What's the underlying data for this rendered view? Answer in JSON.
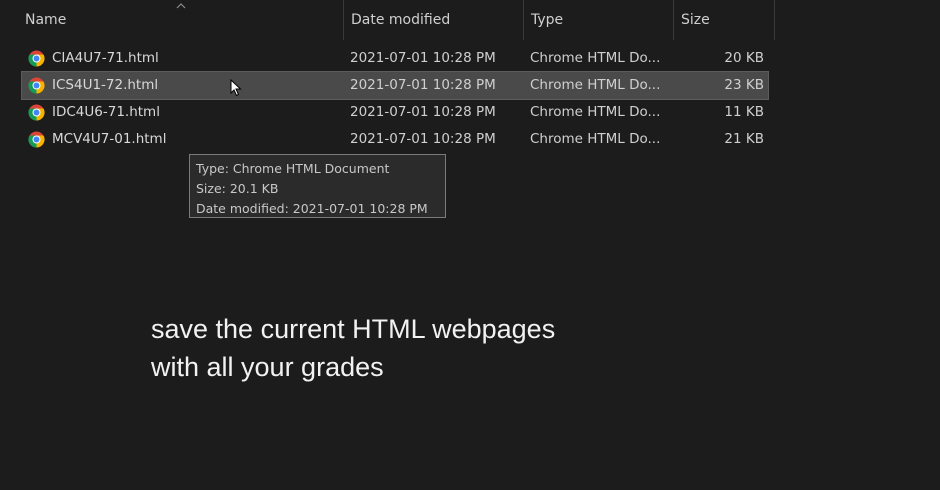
{
  "header": {
    "name": "Name",
    "date_modified": "Date modified",
    "type": "Type",
    "size": "Size",
    "sort_icon": "chevron-up-icon"
  },
  "files": [
    {
      "name": "CIA4U7-71.html",
      "date": "2021-07-01 10:28 PM",
      "type": "Chrome HTML Do...",
      "size": "20 KB",
      "icon": "chrome-icon",
      "selected": false
    },
    {
      "name": "ICS4U1-72.html",
      "date": "2021-07-01 10:28 PM",
      "type": "Chrome HTML Do...",
      "size": "23 KB",
      "icon": "chrome-icon",
      "selected": true
    },
    {
      "name": "IDC4U6-71.html",
      "date": "2021-07-01 10:28 PM",
      "type": "Chrome HTML Do...",
      "size": "11 KB",
      "icon": "chrome-icon",
      "selected": false
    },
    {
      "name": "MCV4U7-01.html",
      "date": "2021-07-01 10:28 PM",
      "type": "Chrome HTML Do...",
      "size": "21 KB",
      "icon": "chrome-icon",
      "selected": false
    }
  ],
  "tooltip": {
    "type_line": "Type: Chrome HTML Document",
    "size_line": "Size: 20.1 KB",
    "date_line": "Date modified: 2021-07-01 10:28 PM"
  },
  "caption": {
    "line1": "save the current HTML webpages",
    "line2": "with all your grades"
  },
  "colors": {
    "background": "#1c1c1c",
    "selected_row": "#4a4a4a",
    "text": "#d8d8d8",
    "caption": "#f2f2f2"
  }
}
